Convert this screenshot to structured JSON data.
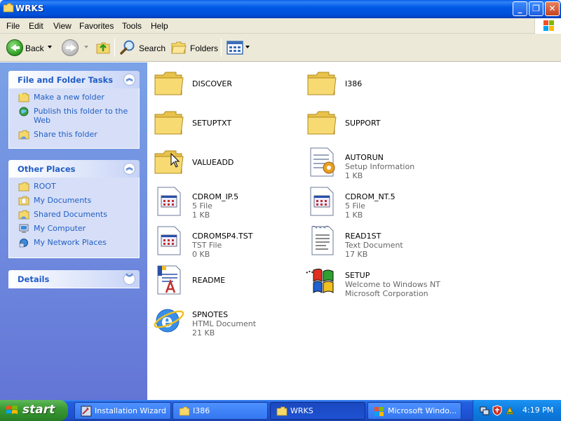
{
  "window": {
    "title": "WRKS",
    "minimize_label": "_",
    "maximize_label": "❐",
    "close_label": "✕"
  },
  "menu": [
    "File",
    "Edit",
    "View",
    "Favorites",
    "Tools",
    "Help"
  ],
  "toolbar": {
    "back_label": "Back",
    "search_label": "Search",
    "folders_label": "Folders"
  },
  "left_pane": {
    "file_tasks": {
      "title": "File and Folder Tasks",
      "items": [
        {
          "label": "Make a new folder",
          "icon": "new-folder-icon"
        },
        {
          "label": "Publish this folder to the Web",
          "icon": "publish-web-icon"
        },
        {
          "label": "Share this folder",
          "icon": "share-folder-icon"
        }
      ]
    },
    "other_places": {
      "title": "Other Places",
      "items": [
        {
          "label": "ROOT",
          "icon": "folder-icon"
        },
        {
          "label": "My Documents",
          "icon": "my-documents-icon"
        },
        {
          "label": "Shared Documents",
          "icon": "shared-documents-icon"
        },
        {
          "label": "My Computer",
          "icon": "my-computer-icon"
        },
        {
          "label": "My Network Places",
          "icon": "network-places-icon"
        }
      ]
    },
    "details": {
      "title": "Details"
    }
  },
  "files": [
    {
      "name": "DISCOVER",
      "type": "",
      "size": "",
      "icon": "folder-icon"
    },
    {
      "name": "I386",
      "type": "",
      "size": "",
      "icon": "folder-icon"
    },
    {
      "name": "SETUPTXT",
      "type": "",
      "size": "",
      "icon": "folder-icon"
    },
    {
      "name": "SUPPORT",
      "type": "",
      "size": "",
      "icon": "folder-icon"
    },
    {
      "name": "VALUEADD",
      "type": "",
      "size": "",
      "icon": "folder-icon"
    },
    {
      "name": "AUTORUN",
      "type": "Setup Information",
      "size": "1 KB",
      "icon": "setup-info-icon"
    },
    {
      "name": "CDROM_IP.5",
      "type": "5 File",
      "size": "1 KB",
      "icon": "generic-file-icon"
    },
    {
      "name": "CDROM_NT.5",
      "type": "5 File",
      "size": "1 KB",
      "icon": "generic-file-icon"
    },
    {
      "name": "CDROMSP4.TST",
      "type": "TST File",
      "size": "0 KB",
      "icon": "generic-file-icon"
    },
    {
      "name": "READ1ST",
      "type": "Text Document",
      "size": "17 KB",
      "icon": "text-document-icon"
    },
    {
      "name": "README",
      "type": "",
      "size": "",
      "icon": "wordpad-document-icon"
    },
    {
      "name": "SETUP",
      "type": "Welcome to Windows NT",
      "size": "Microsoft Corporation",
      "icon": "windows-setup-icon"
    },
    {
      "name": "SPNOTES",
      "type": "HTML Document",
      "size": "21 KB",
      "icon": "html-document-icon"
    }
  ],
  "taskbar": {
    "start_label": "start",
    "buttons": [
      {
        "label": "Installation Wizard",
        "icon": "wizard-icon"
      },
      {
        "label": "I386",
        "icon": "folder-icon"
      },
      {
        "label": "WRKS",
        "icon": "folder-icon"
      },
      {
        "label": "Microsoft Windo...",
        "icon": "windows-flag-icon"
      }
    ],
    "clock": "4:19 PM"
  },
  "colors": {
    "titlebar": "#0058e6",
    "left_pane_top": "#7ba2e7",
    "left_pane_bottom": "#6375d6",
    "link": "#215dc6",
    "taskbar": "#1f56d9",
    "start_green": "#3a9a34"
  }
}
